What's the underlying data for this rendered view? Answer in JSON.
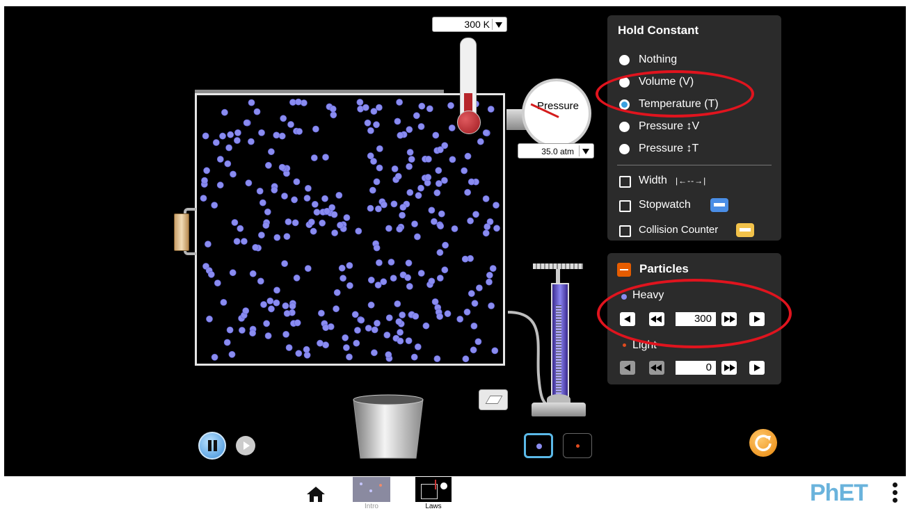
{
  "thermometer": {
    "value": "300 K"
  },
  "gauge": {
    "label": "Pressure",
    "value": "35.0 atm"
  },
  "hold_constant": {
    "title": "Hold Constant",
    "options": [
      {
        "label": "Nothing",
        "selected": false
      },
      {
        "label": "Volume (V)",
        "selected": false
      },
      {
        "label": "Temperature (T)",
        "selected": true
      },
      {
        "label": "Pressure ↕V",
        "selected": false
      },
      {
        "label": "Pressure ↕T",
        "selected": false
      }
    ],
    "width_label": "Width",
    "stopwatch_label": "Stopwatch",
    "collision_counter_label": "Collision Counter"
  },
  "particles": {
    "title": "Particles",
    "heavy": {
      "label": "Heavy",
      "count": "300"
    },
    "light": {
      "label": "Light",
      "count": "0"
    }
  },
  "nav": {
    "screens": [
      {
        "label": "Intro"
      },
      {
        "label": "Laws"
      }
    ]
  },
  "logo": {
    "text": "PhET"
  },
  "colors": {
    "heavy_particle": "#8a8cf0",
    "light_particle": "#e04b1f",
    "accent": "#e65c00",
    "annotation": "#e0141e"
  }
}
